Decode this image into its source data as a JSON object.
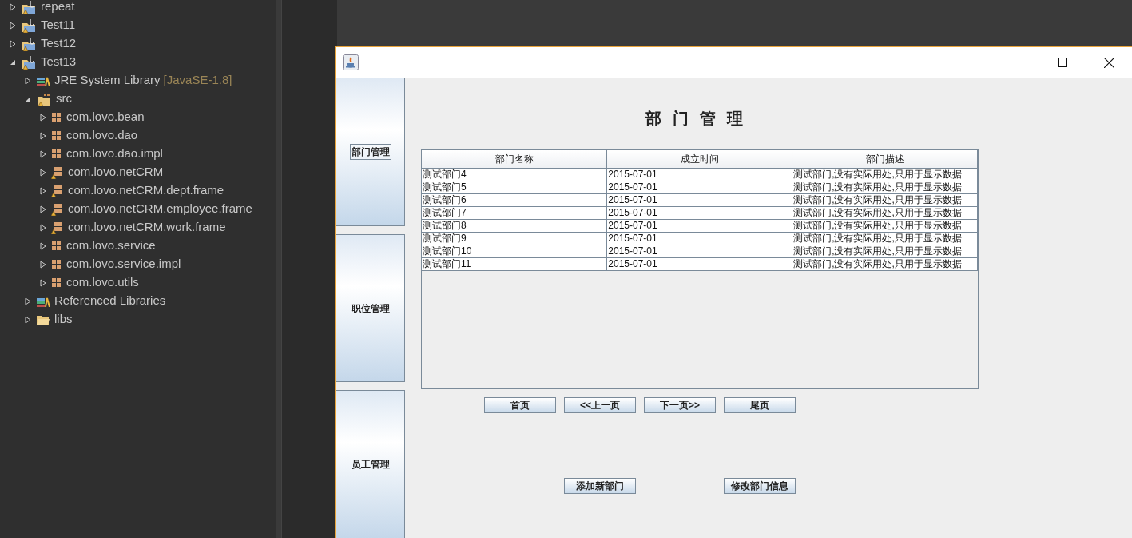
{
  "explorer": {
    "tree": [
      {
        "label": "repeat",
        "kind": "project",
        "expanded": false
      },
      {
        "label": "Test11",
        "kind": "project",
        "expanded": false
      },
      {
        "label": "Test12",
        "kind": "project",
        "expanded": false
      },
      {
        "label": "Test13",
        "kind": "project",
        "expanded": true,
        "children": [
          {
            "label": "JRE System Library",
            "decoration": "[JavaSE-1.8]",
            "kind": "library",
            "expanded": false
          },
          {
            "label": "src",
            "kind": "source",
            "expanded": true,
            "children": [
              {
                "label": "com.lovo.bean",
                "kind": "package",
                "expanded": false
              },
              {
                "label": "com.lovo.dao",
                "kind": "package",
                "expanded": false
              },
              {
                "label": "com.lovo.dao.impl",
                "kind": "package",
                "expanded": false
              },
              {
                "label": "com.lovo.netCRM",
                "kind": "package-warning",
                "expanded": false
              },
              {
                "label": "com.lovo.netCRM.dept.frame",
                "kind": "package-warning",
                "expanded": false
              },
              {
                "label": "com.lovo.netCRM.employee.frame",
                "kind": "package-warning",
                "expanded": false
              },
              {
                "label": "com.lovo.netCRM.work.frame",
                "kind": "package-warning",
                "expanded": false
              },
              {
                "label": "com.lovo.service",
                "kind": "package",
                "expanded": false
              },
              {
                "label": "com.lovo.service.impl",
                "kind": "package",
                "expanded": false
              },
              {
                "label": "com.lovo.utils",
                "kind": "package",
                "expanded": false
              }
            ]
          },
          {
            "label": "Referenced Libraries",
            "kind": "library",
            "expanded": false
          },
          {
            "label": "libs",
            "kind": "folder",
            "expanded": false
          }
        ]
      }
    ]
  },
  "window": {
    "sidebar": [
      {
        "label": "部门管理",
        "selected": true
      },
      {
        "label": "职位管理",
        "selected": false
      },
      {
        "label": "员工管理",
        "selected": false
      }
    ],
    "heading": "部门管理",
    "table": {
      "columns": [
        "部门名称",
        "成立时间",
        "部门描述"
      ],
      "rows": [
        [
          "测试部门4",
          "2015-07-01",
          "测试部门,没有实际用处,只用于显示数据"
        ],
        [
          "测试部门5",
          "2015-07-01",
          "测试部门,没有实际用处,只用于显示数据"
        ],
        [
          "测试部门6",
          "2015-07-01",
          "测试部门,没有实际用处,只用于显示数据"
        ],
        [
          "测试部门7",
          "2015-07-01",
          "测试部门,没有实际用处,只用于显示数据"
        ],
        [
          "测试部门8",
          "2015-07-01",
          "测试部门,没有实际用处,只用于显示数据"
        ],
        [
          "测试部门9",
          "2015-07-01",
          "测试部门,没有实际用处,只用于显示数据"
        ],
        [
          "测试部门10",
          "2015-07-01",
          "测试部门,没有实际用处,只用于显示数据"
        ],
        [
          "测试部门11",
          "2015-07-01",
          "测试部门,没有实际用处,只用于显示数据"
        ]
      ]
    },
    "pager": [
      "首页",
      "<<上一页",
      "下一页>>",
      "尾页"
    ],
    "actions": [
      "添加新部门",
      "修改部门信息"
    ]
  }
}
